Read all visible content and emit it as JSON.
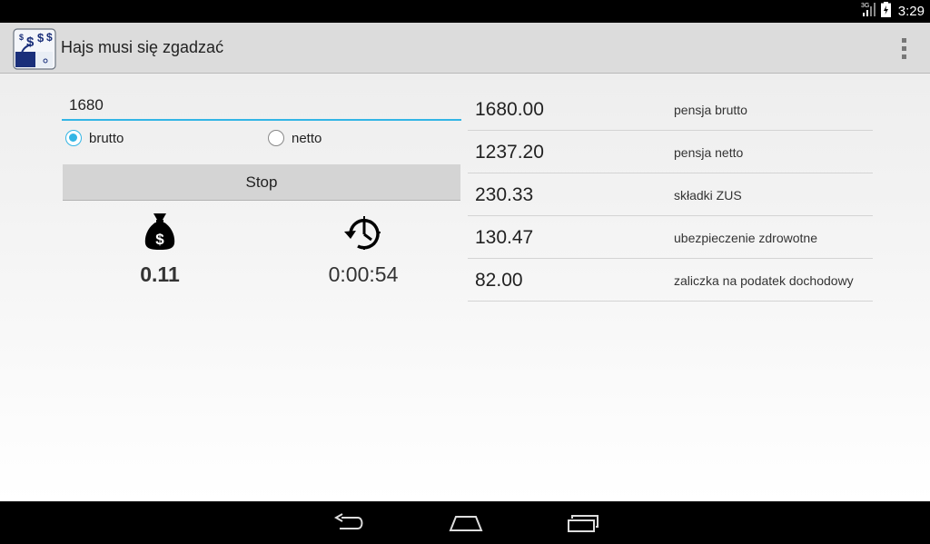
{
  "status_bar": {
    "network": "3G",
    "time": "3:29",
    "icons": [
      "signal-icon",
      "battery-icon"
    ]
  },
  "action_bar": {
    "title": "Hajs musi się zgadzać",
    "icon": "app-logo-icon",
    "overflow_icon": "overflow-menu-icon"
  },
  "form": {
    "amount_value": "1680",
    "radio_options": [
      {
        "label": "brutto",
        "checked": true
      },
      {
        "label": "netto",
        "checked": false
      }
    ],
    "button_label": "Stop"
  },
  "stats": {
    "earned": {
      "icon": "money-bag-icon",
      "value": "0.11"
    },
    "elapsed": {
      "icon": "stopwatch-history-icon",
      "value": "0:00:54"
    }
  },
  "results": [
    {
      "value": "1680.00",
      "label": "pensja brutto"
    },
    {
      "value": "1237.20",
      "label": "pensja netto"
    },
    {
      "value": "230.33",
      "label": "składki ZUS"
    },
    {
      "value": "130.47",
      "label": "ubezpieczenie zdrowotne"
    },
    {
      "value": "82.00",
      "label": "zaliczka na podatek dochodowy"
    }
  ],
  "nav_bar": {
    "buttons": [
      "back-icon",
      "home-icon",
      "recent-apps-icon"
    ]
  },
  "colors": {
    "accent": "#33b5e5",
    "action_bar": "#dcdcdc",
    "button": "#d4d4d4"
  }
}
